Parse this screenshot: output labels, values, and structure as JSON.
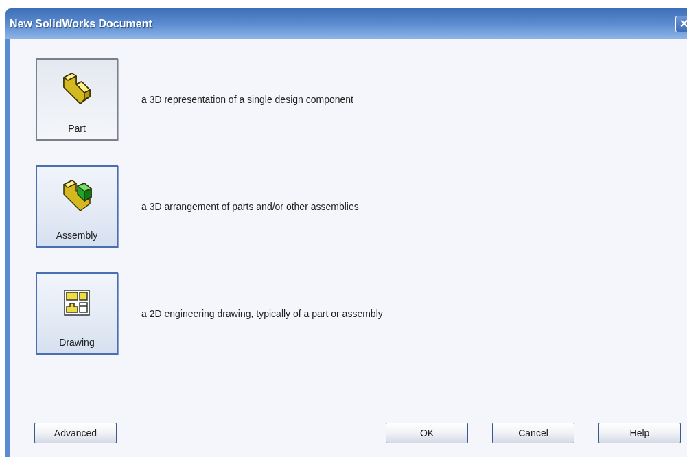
{
  "window": {
    "title": "New SolidWorks Document",
    "close": "✕"
  },
  "templates": [
    {
      "kind": "part",
      "label": "Part",
      "description": "a 3D representation of a single design component",
      "selected": true
    },
    {
      "kind": "assembly",
      "label": "Assembly",
      "description": "a 3D arrangement of parts and/or other assemblies",
      "selected": false
    },
    {
      "kind": "drawing",
      "label": "Drawing",
      "description": "a 2D engineering drawing, typically of a part or assembly",
      "selected": false
    }
  ],
  "buttons_left": [
    "Advanced"
  ],
  "buttons_right": [
    "OK",
    "Cancel",
    "Help"
  ]
}
